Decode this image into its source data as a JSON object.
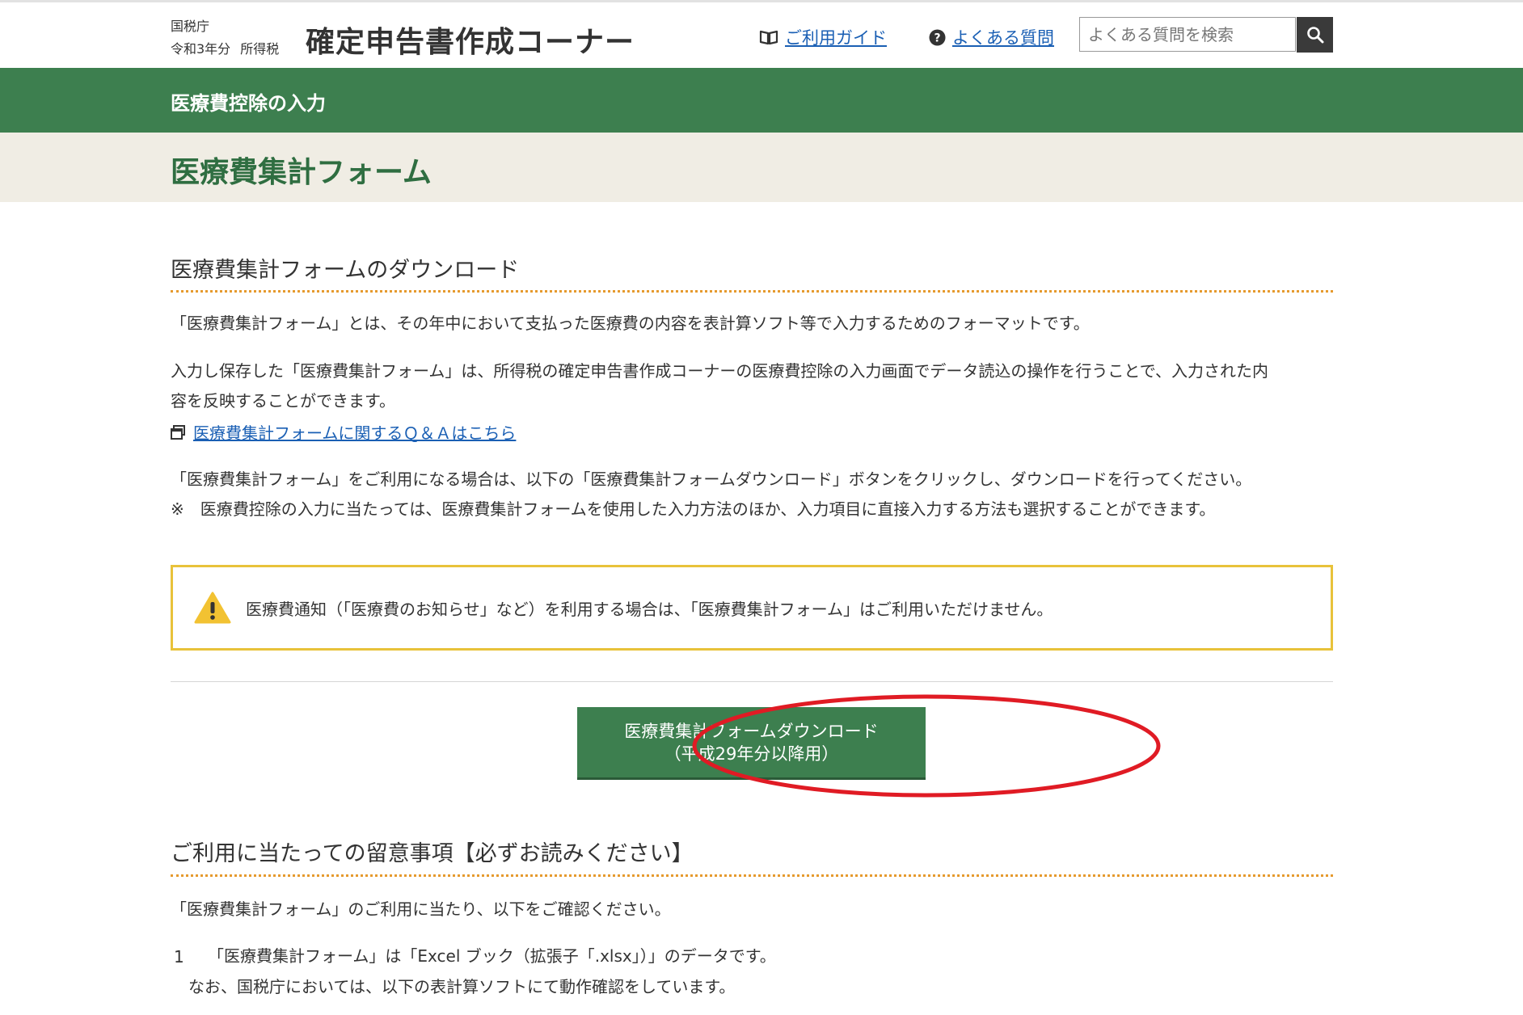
{
  "header": {
    "agency": "国税庁",
    "year": "令和3年分",
    "tax": "所得税",
    "site_title": "確定申告書作成コーナー",
    "guide_link": "ご利用ガイド",
    "faq_link": "よくある質問",
    "search_placeholder": "よくある質問を検索"
  },
  "section_bar": "医療費控除の入力",
  "page_title": "医療費集計フォーム",
  "download_section": {
    "title": "医療費集計フォームのダウンロード",
    "para1": "「医療費集計フォーム」とは、その年中において支払った医療費の内容を表計算ソフト等で入力するためのフォーマットです。",
    "para2_line1": "入力し保存した「医療費集計フォーム」は、所得税の確定申告書作成コーナーの医療費控除の入力画面でデータ読込の操作を行うことで、入力された内",
    "para2_line2": "容を反映することができます。",
    "qa_link": "医療費集計フォームに関するＱ＆Ａはこちら",
    "para3_line1": "「医療費集計フォーム」をご利用になる場合は、以下の「医療費集計フォームダウンロード」ボタンをクリックし、ダウンロードを行ってください。",
    "para3_line2": "※　医療費控除の入力に当たっては、医療費集計フォームを使用した入力方法のほか、入力項目に直接入力する方法も選択することができます。",
    "alert": "医療費通知（「医療費のお知らせ」など）を利用する場合は、「医療費集計フォーム」はご利用いただけません。",
    "button_line1": "医療費集計フォームダウンロード",
    "button_line2": "（平成29年分以降用）"
  },
  "notes_section": {
    "title": "ご利用に当たっての留意事項【必ずお読みください】",
    "intro": "「医療費集計フォーム」のご利用に当たり、以下をご確認ください。",
    "item1_num": "1",
    "item1_line1": "「医療費集計フォーム」は「Excel ブック（拡張子「.xlsx」）」のデータです。",
    "item1_line2": "なお、国税庁においては、以下の表計算ソフトにて動作確認をしています。"
  },
  "colors": {
    "green": "#3d7f4f",
    "title_green": "#2f6e41",
    "beige": "#f0ede4",
    "link": "#1a5fb4",
    "dotted_orange": "#e69a2e",
    "alert_border": "#e8c23a",
    "annotation_red": "#e01b24"
  }
}
